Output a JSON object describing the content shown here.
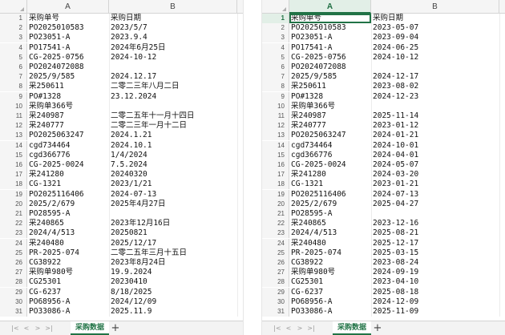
{
  "columns": {
    "a": "A",
    "b": "B"
  },
  "sheet_tab": "采购数据",
  "nav_icons": [
    "first-sheet-icon",
    "prev-sheet-icon",
    "next-sheet-icon",
    "last-sheet-icon"
  ],
  "nav_glyphs": [
    "|<",
    "<",
    ">",
    ">|"
  ],
  "add_sheet_glyph": "+",
  "accent_color": "#217346",
  "left": {
    "rows": [
      {
        "n": "1",
        "a": "采购单号",
        "b": "采购日期"
      },
      {
        "n": "2",
        "a": "PO2025010583",
        "b": "2023/5/7"
      },
      {
        "n": "3",
        "a": "PO23051-A",
        "b": "2023.9.4"
      },
      {
        "n": "4",
        "a": "PO17541-A",
        "b": "2024年6月25日"
      },
      {
        "n": "5",
        "a": "CG-2025-0756",
        "b": "2024-10-12"
      },
      {
        "n": "6",
        "a": "PO2024072088",
        "b": ""
      },
      {
        "n": "7",
        "a": "2025/9/585",
        "b": "2024.12.17"
      },
      {
        "n": "8",
        "a": "采250611",
        "b": "二零二三年八月二日"
      },
      {
        "n": "9",
        "a": "PO#1328",
        "b": "23.12.2024"
      },
      {
        "n": "10",
        "a": "采购单366号",
        "b": ""
      },
      {
        "n": "11",
        "a": "采240987",
        "b": "二零二五年十一月十四日"
      },
      {
        "n": "12",
        "a": "采240777",
        "b": "二零二三年一月十二日"
      },
      {
        "n": "13",
        "a": "PO2025063247",
        "b": "2024.1.21"
      },
      {
        "n": "14",
        "a": "cgd734464",
        "b": "2024.10.1"
      },
      {
        "n": "15",
        "a": "cgd366776",
        "b": "1/4/2024"
      },
      {
        "n": "16",
        "a": "CG-2025-0024",
        "b": "7.5.2024"
      },
      {
        "n": "17",
        "a": "采241280",
        "b": "20240320"
      },
      {
        "n": "18",
        "a": "CG-1321",
        "b": "2023/1/21"
      },
      {
        "n": "19",
        "a": "PO2025116406",
        "b": "2024-07-13"
      },
      {
        "n": "20",
        "a": "2025/2/679",
        "b": "2025年4月27日"
      },
      {
        "n": "21",
        "a": "PO28595-A",
        "b": ""
      },
      {
        "n": "22",
        "a": "采240865",
        "b": "2023年12月16日"
      },
      {
        "n": "23",
        "a": "2024/4/513",
        "b": "20250821"
      },
      {
        "n": "24",
        "a": "采240480",
        "b": "2025/12/17"
      },
      {
        "n": "25",
        "a": "PR-2025-074",
        "b": "二零二五年三月十五日"
      },
      {
        "n": "26",
        "a": "CG38922",
        "b": "2023年8月24日"
      },
      {
        "n": "27",
        "a": "采购单980号",
        "b": "19.9.2024"
      },
      {
        "n": "28",
        "a": "CG25301",
        "b": "20230410"
      },
      {
        "n": "29",
        "a": "CG-6237",
        "b": "8/18/2025"
      },
      {
        "n": "30",
        "a": "PO68956-A",
        "b": "2024/12/09"
      },
      {
        "n": "31",
        "a": "PO33086-A",
        "b": "2025.11.9"
      }
    ]
  },
  "right": {
    "rows": [
      {
        "n": "1",
        "a": "采购单号",
        "b": "采购日期"
      },
      {
        "n": "2",
        "a": "PO2025010583",
        "b": "2023-05-07"
      },
      {
        "n": "3",
        "a": "PO23051-A",
        "b": "2023-09-04"
      },
      {
        "n": "4",
        "a": "PO17541-A",
        "b": "2024-06-25"
      },
      {
        "n": "5",
        "a": "CG-2025-0756",
        "b": "2024-10-12"
      },
      {
        "n": "6",
        "a": "PO2024072088",
        "b": ""
      },
      {
        "n": "7",
        "a": "2025/9/585",
        "b": "2024-12-17"
      },
      {
        "n": "8",
        "a": "采250611",
        "b": "2023-08-02"
      },
      {
        "n": "9",
        "a": "PO#1328",
        "b": "2024-12-23"
      },
      {
        "n": "10",
        "a": "采购单366号",
        "b": ""
      },
      {
        "n": "11",
        "a": "采240987",
        "b": "2025-11-14"
      },
      {
        "n": "12",
        "a": "采240777",
        "b": "2023-01-12"
      },
      {
        "n": "13",
        "a": "PO2025063247",
        "b": "2024-01-21"
      },
      {
        "n": "14",
        "a": "cgd734464",
        "b": "2024-10-01"
      },
      {
        "n": "15",
        "a": "cgd366776",
        "b": "2024-04-01"
      },
      {
        "n": "16",
        "a": "CG-2025-0024",
        "b": "2024-05-07"
      },
      {
        "n": "17",
        "a": "采241280",
        "b": "2024-03-20"
      },
      {
        "n": "18",
        "a": "CG-1321",
        "b": "2023-01-21"
      },
      {
        "n": "19",
        "a": "PO2025116406",
        "b": "2024-07-13"
      },
      {
        "n": "20",
        "a": "2025/2/679",
        "b": "2025-04-27"
      },
      {
        "n": "21",
        "a": "PO28595-A",
        "b": ""
      },
      {
        "n": "22",
        "a": "采240865",
        "b": "2023-12-16"
      },
      {
        "n": "23",
        "a": "2024/4/513",
        "b": "2025-08-21"
      },
      {
        "n": "24",
        "a": "采240480",
        "b": "2025-12-17"
      },
      {
        "n": "25",
        "a": "PR-2025-074",
        "b": "2025-03-15"
      },
      {
        "n": "26",
        "a": "CG38922",
        "b": "2023-08-24"
      },
      {
        "n": "27",
        "a": "采购单980号",
        "b": "2024-09-19"
      },
      {
        "n": "28",
        "a": "CG25301",
        "b": "2023-04-10"
      },
      {
        "n": "29",
        "a": "CG-6237",
        "b": "2025-08-18"
      },
      {
        "n": "30",
        "a": "PO68956-A",
        "b": "2024-12-09"
      },
      {
        "n": "31",
        "a": "PO33086-A",
        "b": "2025-11-09"
      }
    ]
  }
}
